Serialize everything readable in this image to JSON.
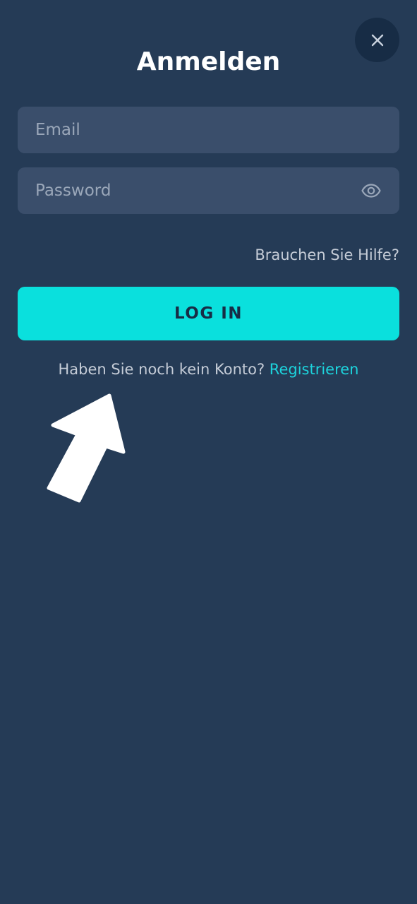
{
  "header": {
    "title": "Anmelden",
    "close_icon": "close-icon"
  },
  "form": {
    "email": {
      "placeholder": "Email",
      "value": ""
    },
    "password": {
      "placeholder": "Password",
      "value": "",
      "toggle_icon": "eye-icon"
    },
    "help_label": "Brauchen Sie Hilfe?",
    "login_label": "LOG IN"
  },
  "register": {
    "prompt": "Haben Sie noch kein Konto?",
    "link_label": "Registrieren"
  },
  "annotation": {
    "icon": "pointer-arrow-icon"
  },
  "colors": {
    "background": "#253b56",
    "input_background": "#3a4e6b",
    "accent": "#0ae0dd",
    "link": "#1dd3dc",
    "close_button": "#172c45"
  }
}
